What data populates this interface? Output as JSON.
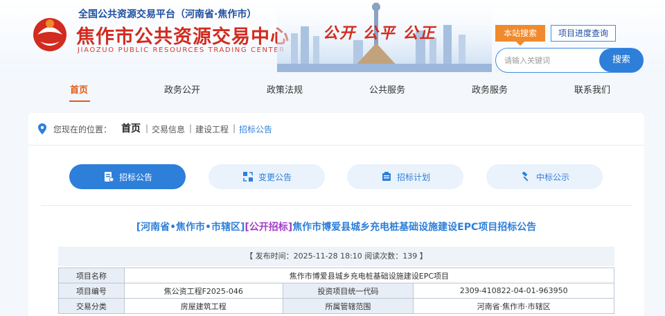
{
  "header": {
    "subtitle": "全国公共资源交易平台（河南省·焦作市）",
    "title": "焦作市公共资源交易中心",
    "title_en": "JIAOZUO PUBLIC RESOURCES TRADING CENTER",
    "slogan": "公开 公平 公正",
    "tabs": {
      "site_search": "本站搜索",
      "progress_query": "项目进度查询"
    },
    "search": {
      "placeholder": "请输入关键词",
      "button": "搜索"
    },
    "colors": {
      "brand_red": "#d22b1f",
      "accent_blue": "#2d7fd9",
      "accent_orange": "#f08a2c"
    }
  },
  "nav": {
    "items": [
      {
        "label": "首页",
        "active": true
      },
      {
        "label": "政务公开"
      },
      {
        "label": "政策法规"
      },
      {
        "label": "公共服务"
      },
      {
        "label": "政务服务"
      },
      {
        "label": "联系我们"
      }
    ]
  },
  "breadcrumb": {
    "prefix": "您现在的位置：",
    "home": "首页",
    "items": [
      "交易信息",
      "建设工程",
      "招标公告"
    ]
  },
  "categories": [
    {
      "label": "招标公告",
      "icon": "document-icon",
      "active": true
    },
    {
      "label": "变更公告",
      "icon": "change-icon"
    },
    {
      "label": "招标计划",
      "icon": "plan-icon"
    },
    {
      "label": "中标公示",
      "icon": "gavel-icon"
    }
  ],
  "article": {
    "region": "[河南省•焦作市•市辖区]",
    "type": "[公开招标]",
    "title": "焦作市博爱县城乡充电桩基础设施建设EPC项目招标公告",
    "meta": "【 发布时间：2025-11-28 18:10    阅读次数：139 】",
    "table": {
      "project_name_label": "项目名称",
      "project_name": "焦作市博爱县城乡充电桩基础设施建设EPC项目",
      "project_no_label": "项目编号",
      "project_no": "焦公资工程F2025-046",
      "invest_code_label": "投资项目统一代码",
      "invest_code": "2309-410822-04-01-963950",
      "category_label": "交易分类",
      "category": "房屋建筑工程",
      "jurisdiction_label": "所属管辖范围",
      "jurisdiction": "河南省·焦作市·市辖区"
    }
  }
}
